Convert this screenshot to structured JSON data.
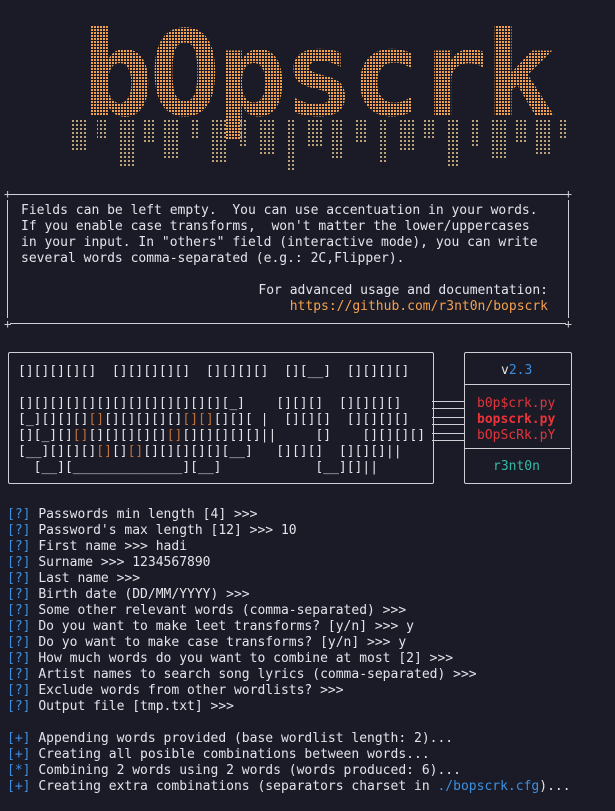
{
  "logo": {
    "text": "bOpscrk",
    "color": "#f2a14f"
  },
  "info_box": {
    "lines": [
      "Fields can be left empty.  You can use accentuation in your words.",
      "If you enable case transforms,  won't matter the lower/uppercases",
      "in your input. In \"others\" field (interactive mode), you can write",
      "several words comma-separated (e.g.: 2C,Flipper)."
    ],
    "docs_label": "For advanced usage and documentation:",
    "docs_url": "https://github.com/r3nt0n/bopscrk"
  },
  "banner": {
    "version_prefix": "v",
    "version_number": "2.3",
    "file_variants": [
      "b0p$crk.py",
      "bopscrk.py",
      "bOpScRk.pY"
    ],
    "author": "r3nt0n"
  },
  "prompts": [
    {
      "tag": "[?]",
      "text": "Passwords min length [4] >>>",
      "answer": ""
    },
    {
      "tag": "[?]",
      "text": "Password's max length [12] >>>",
      "answer": "10"
    },
    {
      "tag": "[?]",
      "text": "First name >>>",
      "answer": "hadi"
    },
    {
      "tag": "[?]",
      "text": "Surname >>>",
      "answer": "1234567890"
    },
    {
      "tag": "[?]",
      "text": "Last name >>>",
      "answer": ""
    },
    {
      "tag": "[?]",
      "text": "Birth date (DD/MM/YYYY) >>>",
      "answer": ""
    },
    {
      "tag": "[?]",
      "text": "Some other relevant words (comma-separated) >>>",
      "answer": ""
    },
    {
      "tag": "[?]",
      "text": "Do you want to make leet transforms? [y/n] >>>",
      "answer": "y"
    },
    {
      "tag": "[?]",
      "text": "Do yo want to make case transforms? [y/n] >>>",
      "answer": "y"
    },
    {
      "tag": "[?]",
      "text": "How much words do you want to combine at most [2] >>>",
      "answer": ""
    },
    {
      "tag": "[?]",
      "text": "Artist names to search song lyrics (comma-separated) >>>",
      "answer": ""
    },
    {
      "tag": "[?]",
      "text": "Exclude words from other wordlists? >>>",
      "answer": ""
    },
    {
      "tag": "[?]",
      "text": "Output file [tmp.txt] >>>",
      "answer": ""
    }
  ],
  "status": [
    {
      "tag": "[+]",
      "text": "Appending words provided (base wordlist length: 2)",
      "dots": "..."
    },
    {
      "tag": "[+]",
      "text": "Creating all posible combinations between words",
      "dots": "..."
    },
    {
      "tag": "[*]",
      "text": "Combining 2 words using 2 words (words produced: 6)",
      "dots": "..."
    },
    {
      "tag": "[+]",
      "text": "Creating extra combinations (separators charset in ",
      "path": "./bopscrk.cfg",
      "tail": ")",
      "dots": "..."
    }
  ]
}
